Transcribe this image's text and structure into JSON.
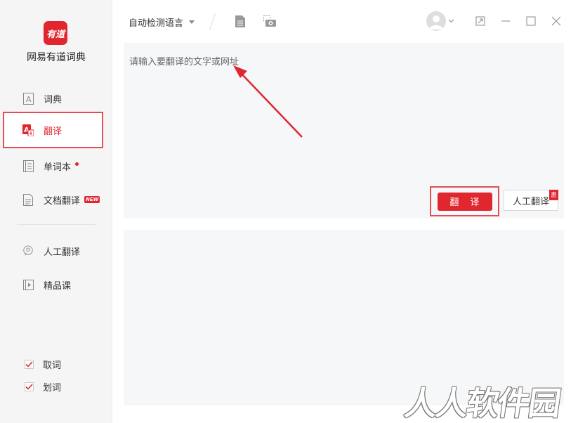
{
  "app": {
    "logo_text": "有道",
    "name": "网易有道词典"
  },
  "sidebar": {
    "items": [
      {
        "label": "词典",
        "icon": "dictionary-icon"
      },
      {
        "label": "翻译",
        "icon": "translate-icon",
        "active": true
      },
      {
        "label": "单词本",
        "icon": "wordbook-icon",
        "dot": true
      },
      {
        "label": "文档翻译",
        "icon": "document-icon",
        "badge": "NEW"
      },
      {
        "label": "人工翻译",
        "icon": "human-translate-icon"
      },
      {
        "label": "精品课",
        "icon": "course-icon"
      }
    ],
    "options": [
      {
        "label": "取词",
        "checked": true
      },
      {
        "label": "划词",
        "checked": true
      }
    ]
  },
  "toolbar": {
    "language": "自动检测语言"
  },
  "input": {
    "placeholder": "请输入要翻译的文字或网址"
  },
  "actions": {
    "translate_label": "翻 译",
    "human_translate_label": "人工翻译",
    "human_badge": "惠"
  },
  "watermark": "人人软件园",
  "colors": {
    "accent": "#e0262f",
    "highlight_border": "#e24e54",
    "sidebar_bg": "#f5f5f5",
    "panel_bg": "#f6f7f8"
  }
}
